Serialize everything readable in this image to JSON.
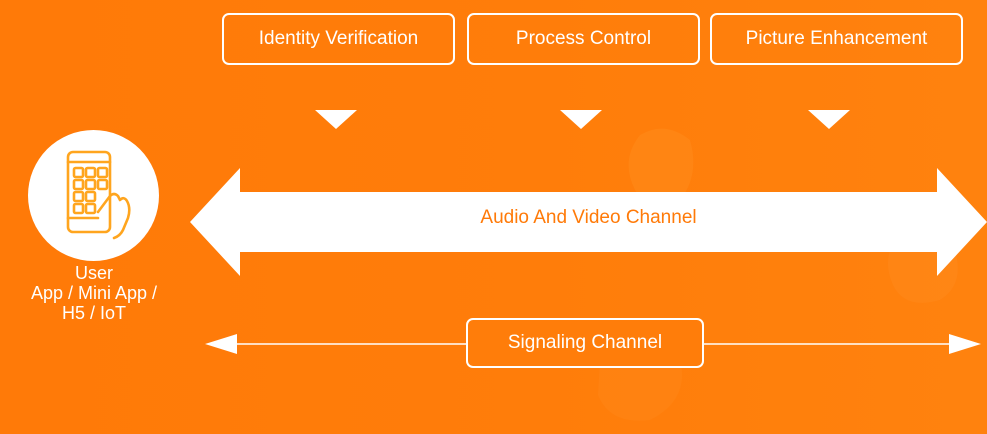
{
  "features": [
    {
      "label": "Identity Verification"
    },
    {
      "label": "Process Control"
    },
    {
      "label": "Picture Enhancement"
    }
  ],
  "user": {
    "title": "User",
    "line1": "App / Mini App /",
    "line2": "H5 / IoT",
    "icon": "mobile-phone-hand-icon"
  },
  "channels": {
    "audio_video": "Audio And Video Channel",
    "signaling": "Signaling Channel"
  },
  "colors": {
    "background": "#ff7a08",
    "foreground": "#ffffff",
    "icon_accent": "#ffa51e"
  }
}
